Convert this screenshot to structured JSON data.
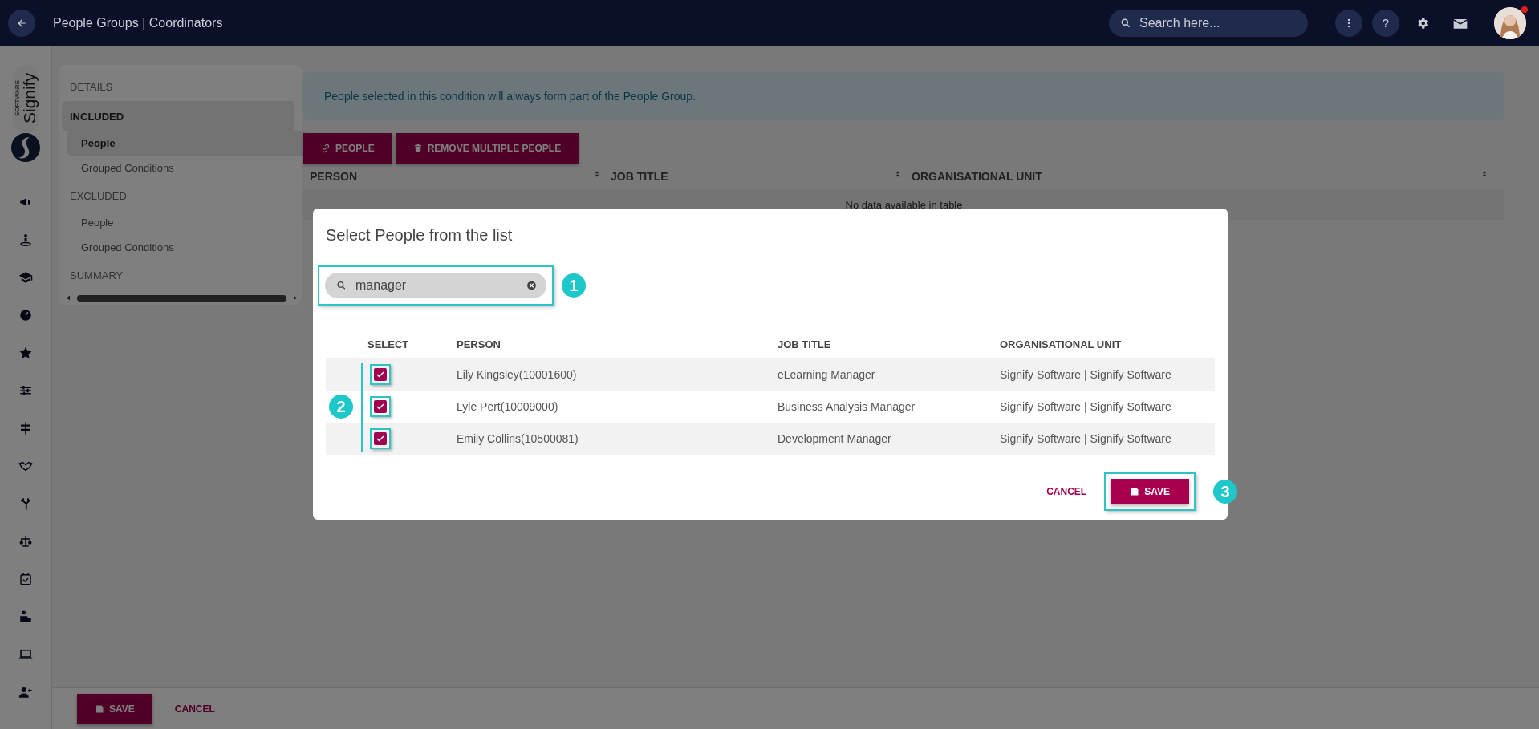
{
  "top_bar": {
    "title": "People Groups | Coordinators",
    "search": {
      "placeholder": "Search here..."
    },
    "help_label": "?",
    "notification": true
  },
  "brand": {
    "name": "Signify",
    "tagline": "SOFTWARE"
  },
  "details_nav": {
    "items": [
      {
        "label": "DETAILS",
        "kind": "section",
        "selected": false
      },
      {
        "label": "INCLUDED",
        "kind": "section",
        "selected": true
      },
      {
        "label": "People",
        "kind": "sub",
        "selected": true
      },
      {
        "label": "Grouped Conditions",
        "kind": "sub",
        "selected": false
      },
      {
        "label": "EXCLUDED",
        "kind": "section",
        "selected": false
      },
      {
        "label": "People",
        "kind": "sub",
        "selected": false
      },
      {
        "label": "Grouped Conditions",
        "kind": "sub",
        "selected": false
      },
      {
        "label": "SUMMARY",
        "kind": "section",
        "selected": false
      }
    ]
  },
  "info_message": "People selected in this condition will always form part of the People Group.",
  "actions": [
    {
      "label": "PEOPLE",
      "kind": "link"
    },
    {
      "label": "REMOVE MULTIPLE PEOPLE",
      "kind": "delete"
    }
  ],
  "table": {
    "columns": [
      "PERSON",
      "JOB TITLE",
      "ORGANISATIONAL UNIT"
    ],
    "empty_message": "No data available in table"
  },
  "footer": {
    "buttons": [
      {
        "label": "SAVE",
        "kind": "primary"
      },
      {
        "label": "CANCEL",
        "kind": "text"
      }
    ]
  },
  "dialog": {
    "title": "Select People from the list",
    "search": {
      "value": "manager"
    },
    "columns": [
      "SELECT",
      "PERSON",
      "JOB TITLE",
      "ORGANISATIONAL UNIT"
    ],
    "rows": [
      {
        "checked": true,
        "person": "Lily Kingsley(10001600)",
        "job_title": "eLearning Manager",
        "unit": "Signify Software | Signify Software"
      },
      {
        "checked": true,
        "person": "Lyle Pert(10009000)",
        "job_title": "Business Analysis Manager",
        "unit": "Signify Software | Signify Software"
      },
      {
        "checked": true,
        "person": "Emily Collins(10500081)",
        "job_title": "Development Manager",
        "unit": "Signify Software | Signify Software"
      }
    ],
    "buttons": [
      {
        "label": "CANCEL",
        "kind": "text"
      },
      {
        "label": "SAVE",
        "kind": "primary"
      }
    ]
  },
  "annotations": [
    "1",
    "2",
    "3"
  ]
}
